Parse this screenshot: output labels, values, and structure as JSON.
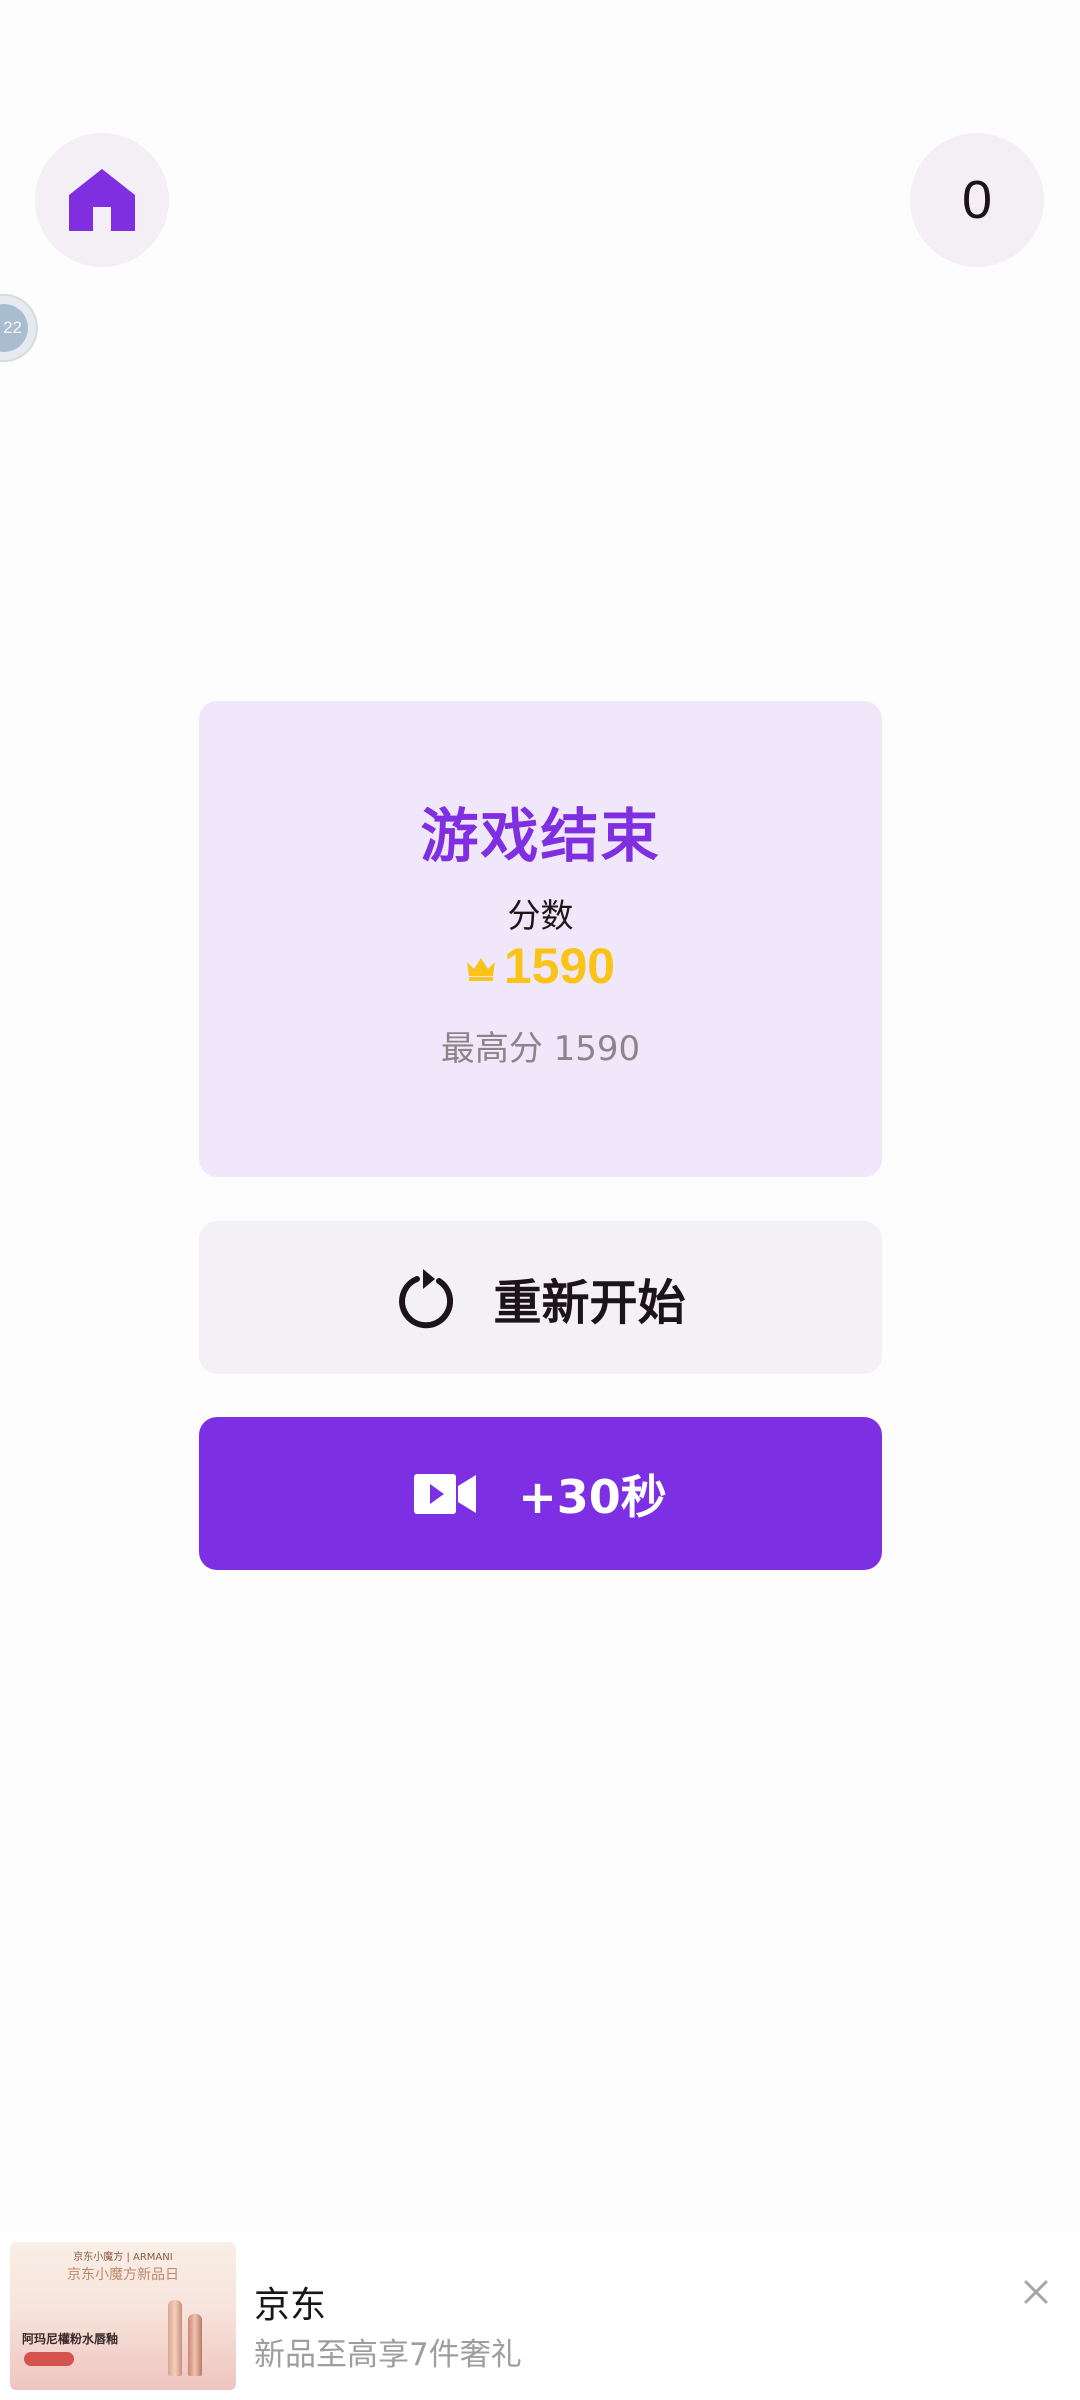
{
  "header": {
    "home_icon": "home-icon",
    "score_counter": "0"
  },
  "floating_bubble": {
    "text": "22"
  },
  "result": {
    "title": "游戏结束",
    "score_label": "分数",
    "score_icon": "crown-icon",
    "score_value": "1590",
    "best_label": "最高分",
    "best_value": "1590"
  },
  "actions": {
    "restart_label": "重新开始",
    "restart_icon": "refresh-icon",
    "bonus_label": "+30秒",
    "bonus_icon": "video-camera-icon"
  },
  "ad": {
    "thumb_top_text": "京东小魔方 | ARMANI",
    "thumb_headline": "京东小魔方新品日",
    "thumb_product": "阿玛尼權粉水唇釉",
    "title": "京东",
    "subtitle": "新品至高享7件奢礼",
    "close_icon": "close-icon"
  },
  "colors": {
    "accent": "#7d30e3",
    "card_bg": "#f0e8fa",
    "score_gold": "#f9c318",
    "title_purple": "#7f2fe0"
  }
}
